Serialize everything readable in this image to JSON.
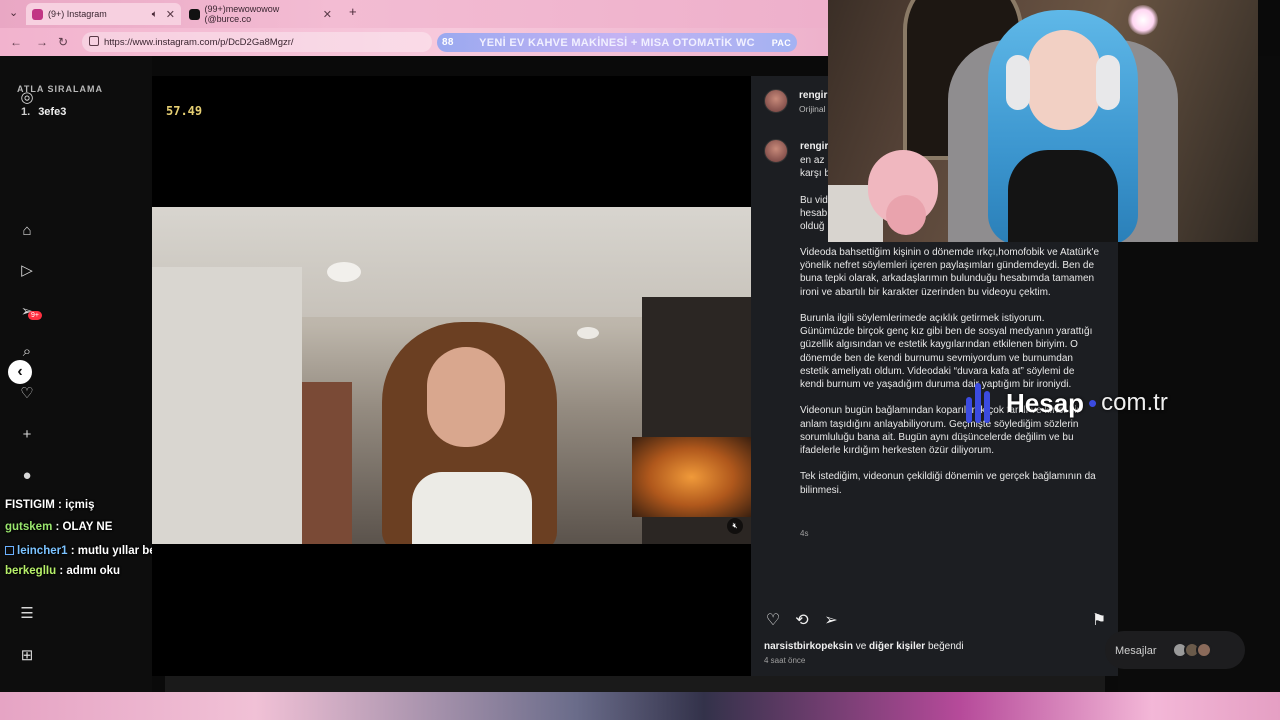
{
  "browser": {
    "tabs": [
      {
        "label": "(9+) Instagram",
        "favicon_color": "#c13584"
      },
      {
        "label": "(99+)mewowowow (@burce.co",
        "favicon_color": "#111111"
      }
    ],
    "url": "https://www.instagram.com/p/DcD2Ga8Mgzr/",
    "marquee": {
      "number": "88",
      "text": "YENİ EV KAHVE MAKİNESİ + MISA OTOMATİK WC",
      "suffix": "PAC"
    }
  },
  "overlay": {
    "leaderboard_title": "ATLA SIRALAMA",
    "leaderboard": [
      {
        "rank": "1.",
        "name": "3efe3"
      }
    ],
    "timer": "57.49",
    "chat": [
      {
        "user": "FISTIGIM",
        "message": ": içmiş",
        "color": "#ffffff",
        "platform_icon": false
      },
      {
        "user": "gutskem",
        "message": ": OLAY NE",
        "color": "#9ae66e",
        "platform_icon": false
      },
      {
        "user": "leincher1",
        "message": ": mutlu yıllar berke",
        "color": "#7cc3ff",
        "platform_icon": true
      },
      {
        "user": "berkeglIu",
        "message": ": adımı oku",
        "color": "#b7f06a",
        "platform_icon": false
      }
    ],
    "watermark": {
      "brand": "Hesap",
      "tld": "com.tr",
      "color": "#3b4be0"
    }
  },
  "instagram": {
    "sidebar_badge": "9+",
    "post": {
      "author": "rengir",
      "author_sub": "Orijinal",
      "comment_author": "rengir",
      "caption_fragments": [
        "en az",
        "karşı b",
        "Bu vide",
        "hesab",
        "olduğ"
      ],
      "caption_paragraphs": [
        "Videoda bahsettiğim kişinin o dönemde ırkçı,homofobik ve Atatürk'e yönelik nefret söylemleri içeren paylaşımları gündemdeydi. Ben de buna tepki olarak, arkadaşlarımın bulunduğu hesabımda tamamen ironi ve abartılı bir karakter üzerinden bu videoyu çektim.",
        "Burunla ilgili söylemlerimede açıklık getirmek istiyorum. Günümüzde birçok genç kız gibi ben de sosyal medyanın yarattığı güzellik algısından ve estetik kaygılarından etkilenen biriyim. O dönemde ben de kendi burnumu sevmiyordum ve burnumdan estetik ameliyatı oldum. Videodaki “duvara kafa at” söylemi de kendi burnum ve yaşadığım duruma dair yaptığım bir ironiydi.",
        "Videonun bugün bağlamından koparılarak çok farklı ve kırıcı bir anlam taşıdığını anlayabiliyorum. Geçmişte söylediğim sözlerin sorumluluğu bana ait. Bugün aynı düşüncelerde değilim ve bu ifadelerle kırdığım herkesten özür diliyorum.",
        "Tek istediğim, videonun çekildiği dönemin ve gerçek bağlamının da bilinmesi."
      ],
      "caption_time": "4s",
      "liked_by_user": "narsistbirkopeksin",
      "liked_by_rest": " ve ",
      "liked_by_others": "diğer kişiler",
      "liked_by_suffix": " beğendi",
      "posted": "4 saat önce"
    },
    "messages_label": "Mesajlar"
  }
}
